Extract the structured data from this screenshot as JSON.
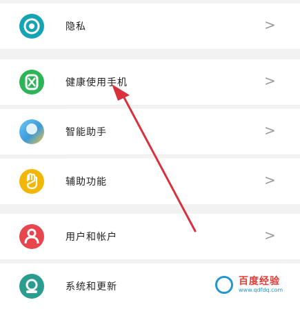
{
  "settings_list": {
    "items": [
      {
        "label": "隐私",
        "icon": "privacy-icon",
        "color": "#16a3b3",
        "chevron": ">"
      },
      {
        "label": "健康使用手机",
        "icon": "hourglass-icon",
        "color": "#2db457",
        "chevron": ">"
      },
      {
        "label": "智能助手",
        "icon": "assistant-icon",
        "color": "#3a9ad9",
        "chevron": ">"
      },
      {
        "label": "辅助功能",
        "icon": "hand-icon",
        "color": "#f2b705",
        "chevron": ">"
      },
      {
        "label": "用户和帐户",
        "icon": "user-icon",
        "color": "#e8454f",
        "chevron": ">"
      },
      {
        "label": "系统和更新",
        "icon": "system-icon",
        "color": "#2a9d8f",
        "chevron": ""
      }
    ]
  },
  "watermark": {
    "title": "百度经验",
    "url": "www.qdfdq.com"
  },
  "colors": {
    "annotation_arrow": "#d9303e",
    "background": "#f2f2f2"
  }
}
